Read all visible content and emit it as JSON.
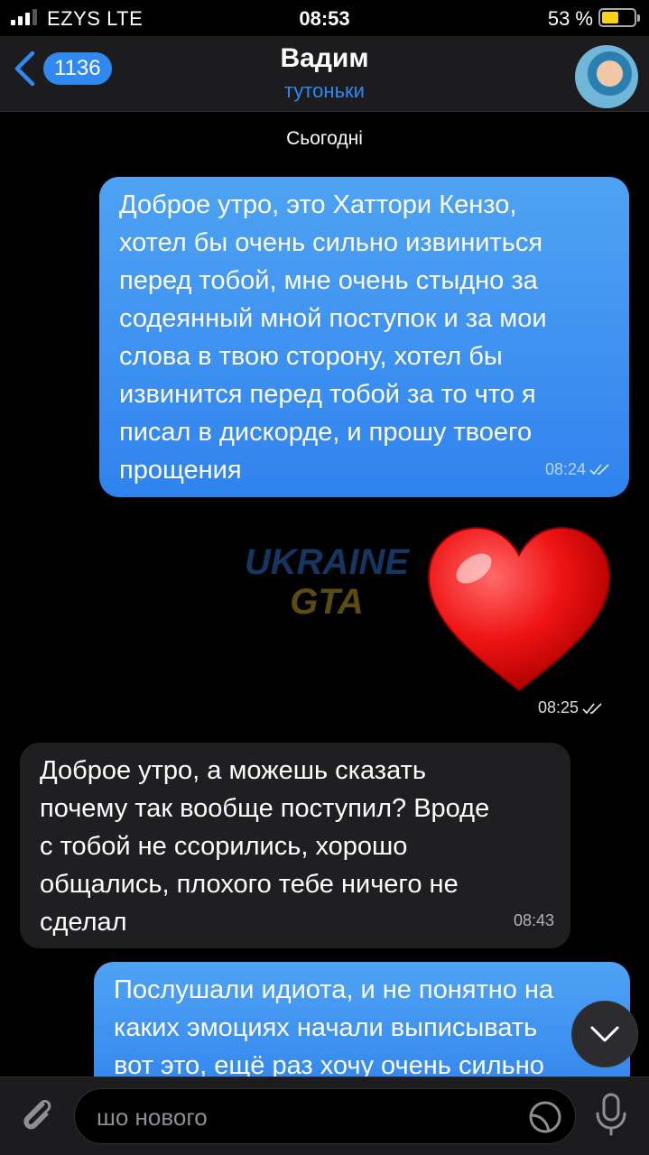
{
  "status": {
    "carrier": "EZYS  LTE",
    "time": "08:53",
    "battery_percent": "53 %",
    "battery_level": 0.53
  },
  "header": {
    "badge": "1136",
    "title": "Вадим",
    "subtitle": "тутоньки",
    "accent_color": "#2f89f0"
  },
  "date_separator": "Сьогодні",
  "messages": [
    {
      "direction": "out",
      "text": "Доброе утро, это Хаттори Кензо,\nхотел бы очень сильно извиниться\nперед тобой, мне очень стыдно за\nсодеянный мной поступок и за мои\nслова в твою сторону, хотел бы\nизвинится перед тобой за то что я\nписал в дискорде, и прошу твоего\nпрощения",
      "time": "08:24"
    },
    {
      "direction": "out",
      "type": "sticker",
      "sticker": "red-heart",
      "time": "08:25"
    },
    {
      "direction": "in",
      "text": "Доброе утро, а можешь сказать\nпочему так вообще поступил? Вроде\nс тобой не ссорились, хорошо\nобщались, плохого тебе ничего не\nсделал",
      "time": "08:43"
    },
    {
      "direction": "out",
      "text": "Послушали идиота, и не понятно на\nкаких эмоциях начали выписывать\nвот это, ещё раз хочу очень сильно"
    }
  ],
  "watermark": {
    "line1": "UKRAINE",
    "line2": "GTA"
  },
  "composer": {
    "placeholder": "шо нового",
    "icons": [
      "paperclip-icon",
      "sticker-icon",
      "microphone-icon"
    ]
  }
}
